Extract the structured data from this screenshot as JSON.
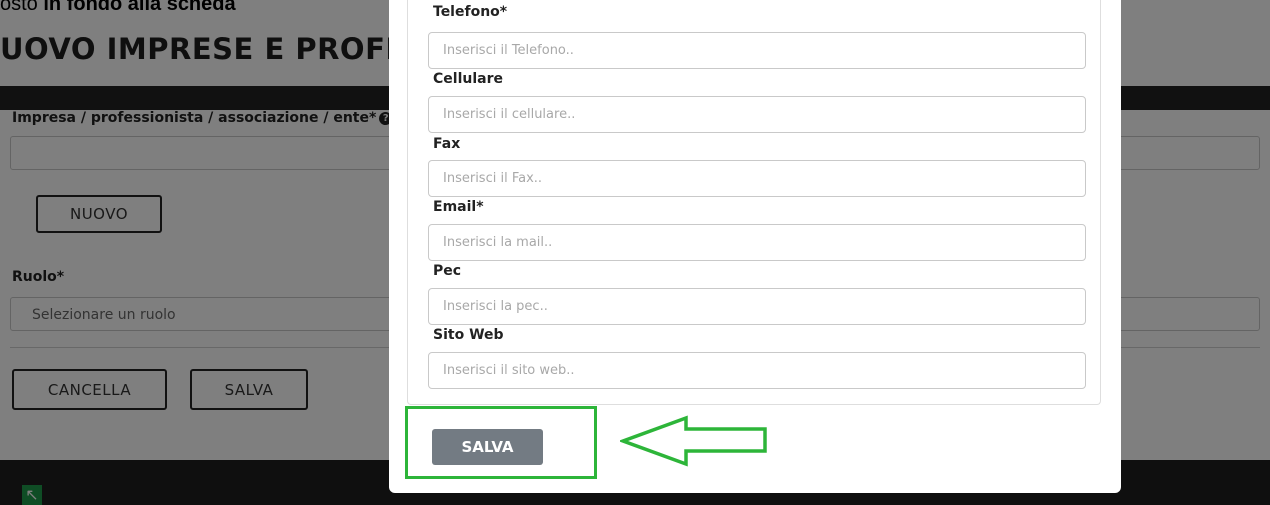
{
  "document": {
    "prefix": "osto ",
    "bold_text": "in fondo alla scheda"
  },
  "background": {
    "title": "UOVO IMPRESE E PROFESS",
    "field_impresa_label": "Impresa / professionista / associazione / ente*",
    "nuovo_button": "NUOVO",
    "ruolo_label": "Ruolo*",
    "ruolo_select_value": "Selezionare un ruolo",
    "cancella_button": "CANCELLA",
    "salva_button": "SALVA"
  },
  "modal": {
    "fields": [
      {
        "label": "Telefono*",
        "placeholder": "Inserisci il Telefono.."
      },
      {
        "label": "Cellulare",
        "placeholder": "Inserisci il cellulare.."
      },
      {
        "label": "Fax",
        "placeholder": "Inserisci il Fax.."
      },
      {
        "label": "Email*",
        "placeholder": "Inserisci la mail.."
      },
      {
        "label": "Pec",
        "placeholder": "Inserisci la pec.."
      },
      {
        "label": "Sito Web",
        "placeholder": "Inserisci il sito web.."
      }
    ],
    "save_button": "SALVA"
  },
  "annotation": {
    "highlight_color": "#2db539",
    "arrow_color": "#2db539"
  }
}
